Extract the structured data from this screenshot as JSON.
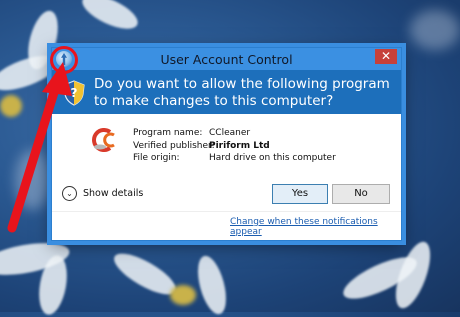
{
  "dialog": {
    "title": "User Account Control",
    "close_glyph": "✕",
    "question": "Do you want to allow the following program to make changes to this computer?",
    "fields": {
      "program_name_label": "Program name:",
      "program_name_value": "CCleaner",
      "publisher_label": "Verified publisher:",
      "publisher_value": "Piriform Ltd",
      "origin_label": "File origin:",
      "origin_value": "Hard drive on this computer"
    },
    "show_details": "Show details",
    "yes_button": "Yes",
    "no_button": "No",
    "notifications_link": "Change when these notifications appear"
  },
  "colors": {
    "title_bar": "#3b90e2",
    "question_band": "#1d6fbb",
    "close_button": "#c6403a",
    "annotation_arrow": "#e8141c"
  },
  "icons": {
    "system": "uac-shield-icon",
    "question": "shield-icon",
    "program": "ccleaner-logo-icon",
    "details": "chevron-down-icon",
    "annotation": "red-arrow-annotation"
  }
}
